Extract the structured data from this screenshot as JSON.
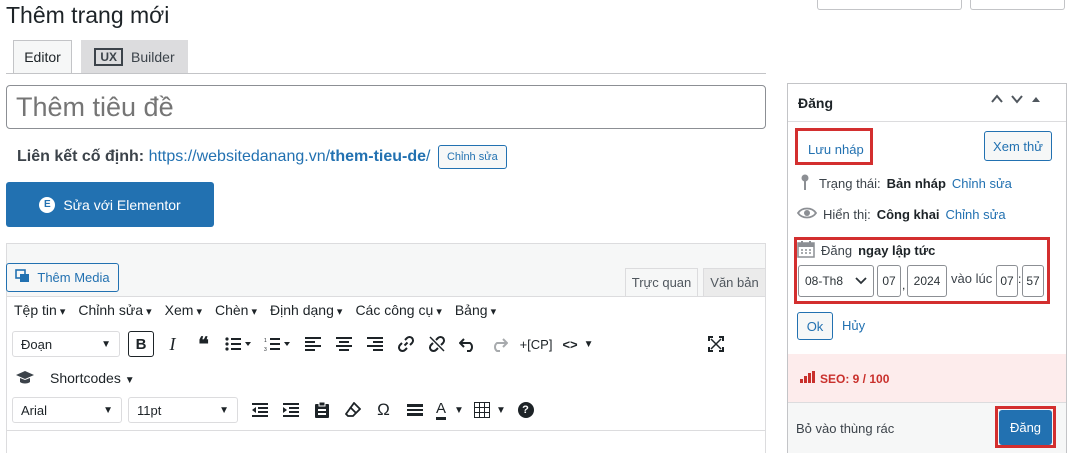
{
  "page": {
    "title": "Thêm trang mới"
  },
  "tabs": [
    {
      "label": "Editor"
    },
    {
      "badge": "UX",
      "label": "Builder"
    }
  ],
  "title_input": {
    "placeholder": "Thêm tiêu đề"
  },
  "permalink": {
    "label": "Liên kết cố định:",
    "base": "https://websitedanang.vn/",
    "slug": "them-tieu-de",
    "trail": "/",
    "edit_label": "Chỉnh sửa"
  },
  "elementor": {
    "icon_glyph": "E",
    "label": "Sửa với Elementor"
  },
  "media": {
    "label": "Thêm Media"
  },
  "editor_modes": {
    "visual": "Trực quan",
    "text": "Văn bản"
  },
  "menubar": [
    "Tệp tin",
    "Chỉnh sửa",
    "Xem",
    "Chèn",
    "Định dạng",
    "Các công cụ",
    "Bảng"
  ],
  "toolbar": {
    "format_select": "Đoạn",
    "bold": "B",
    "italic": "I",
    "quote": "❝",
    "cp_label": "+[CP]",
    "code_glyph": "<>",
    "shortcodes": "Shortcodes",
    "font_family": "Arial",
    "font_size": "11pt",
    "omega": "Ω",
    "text_color": "A",
    "help": "?"
  },
  "publish_box": {
    "title": "Đăng",
    "save_draft": "Lưu nháp",
    "preview": "Xem thử",
    "status_label": "Trạng thái:",
    "status_value": "Bản nháp",
    "status_edit": "Chỉnh sửa",
    "visibility_label": "Hiển thị:",
    "visibility_value": "Công khai",
    "visibility_edit": "Chỉnh sửa",
    "schedule_prefix": "Đăng",
    "schedule_value": "ngay lập tức",
    "month": "08-Th8",
    "day": "07",
    "year": "2024",
    "at_label": "vào lúc",
    "hour": "07",
    "minute": "57",
    "ok": "Ok",
    "cancel": "Hủy",
    "seo": "SEO: 9 / 100",
    "trash": "Bỏ vào thùng rác",
    "publish": "Đăng"
  },
  "colors": {
    "accent": "#2271b1",
    "highlight": "#d32f2f",
    "seo_bg": "#fdecec",
    "seo_text": "#c9302c"
  }
}
